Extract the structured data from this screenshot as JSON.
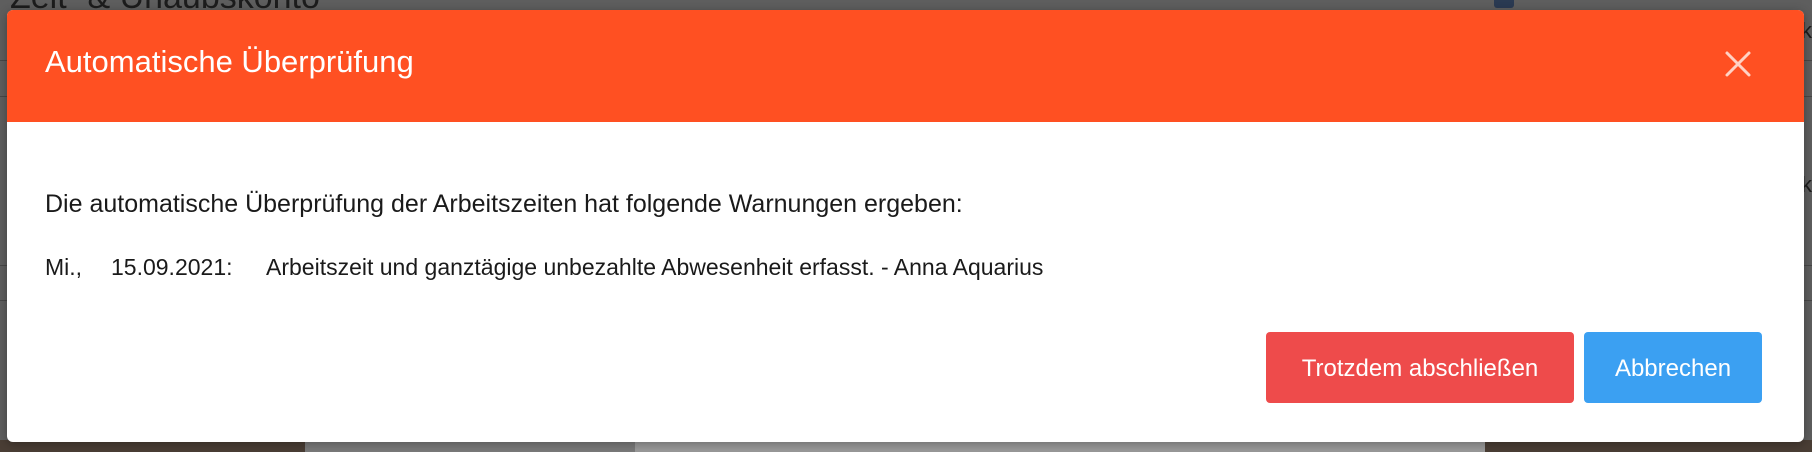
{
  "background": {
    "title": "Zeit- & Urlaubskonto",
    "edge_char_1": "k",
    "edge_char_2": "k"
  },
  "modal": {
    "title": "Automatische Überprüfung",
    "close_icon": "close-icon",
    "intro": "Die automatische Überprüfung der Arbeitszeiten hat folgende Warnungen ergeben:",
    "warnings": [
      {
        "day": "Mi.,",
        "date": "15.09.2021:",
        "message": "Arbeitszeit und ganztägige unbezahlte Abwesenheit erfasst. - Anna Aquarius"
      }
    ],
    "buttons": {
      "confirm_label": "Trotzdem abschließen",
      "cancel_label": "Abbrechen"
    }
  },
  "colors": {
    "header": "#ff5022",
    "danger": "#ee4b4b",
    "primary": "#3ba0f2"
  }
}
